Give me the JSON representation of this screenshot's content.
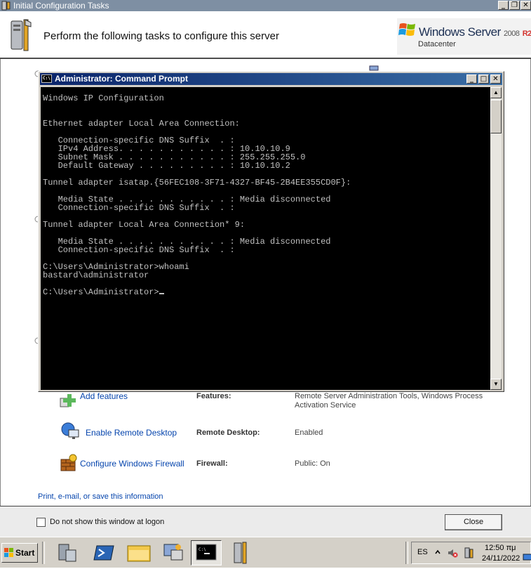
{
  "ict_window": {
    "title": "Initial Configuration Tasks",
    "header_text": "Perform the following tasks to configure this server",
    "logo": {
      "product": "Windows Server",
      "version": "2008",
      "release": "R2",
      "edition": "Datacenter"
    },
    "tasks": [
      {
        "link": "Add features",
        "key": "Features:",
        "value": "Remote Server Administration Tools, Windows Process Activation Service"
      },
      {
        "link": "Enable Remote Desktop",
        "key": "Remote Desktop:",
        "value": "Enabled"
      },
      {
        "link": "Configure Windows Firewall",
        "key": "Firewall:",
        "value": "Public: On"
      }
    ],
    "print_link": "Print, e-mail, or save this information",
    "checkbox_label": "Do not show this window at logon",
    "close_label": "Close"
  },
  "cmd_window": {
    "title": "Administrator: Command Prompt",
    "output": "Windows IP Configuration\n\n\nEthernet adapter Local Area Connection:\n\n   Connection-specific DNS Suffix  . :\n   IPv4 Address. . . . . . . . . . . : 10.10.10.9\n   Subnet Mask . . . . . . . . . . . : 255.255.255.0\n   Default Gateway . . . . . . . . . : 10.10.10.2\n\nTunnel adapter isatap.{56FEC108-3F71-4327-BF45-2B4EE355CD0F}:\n\n   Media State . . . . . . . . . . . : Media disconnected\n   Connection-specific DNS Suffix  . :\n\nTunnel adapter Local Area Connection* 9:\n\n   Media State . . . . . . . . . . . : Media disconnected\n   Connection-specific DNS Suffix  . :\n\nC:\\Users\\Administrator>whoami\nbastard\\administrator\n\nC:\\Users\\Administrator>"
  },
  "taskbar": {
    "start_label": "Start",
    "language": "ES",
    "clock_time": "12:50 πμ",
    "clock_date": "24/11/2022"
  },
  "colors": {
    "title_bar_blue": "#0a246a",
    "console_bg": "#000000",
    "console_text": "#c0c0c0",
    "link": "#0645ad",
    "r2_red": "#d2322d"
  }
}
